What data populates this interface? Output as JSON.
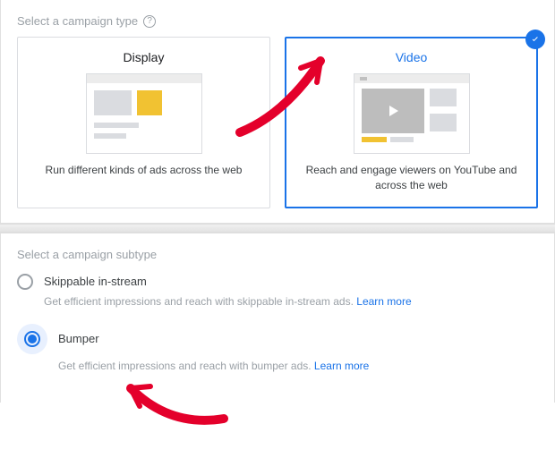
{
  "section_type_label": "Select a campaign type",
  "cards": {
    "display": {
      "title": "Display",
      "desc": "Run different kinds of ads across the web"
    },
    "video": {
      "title": "Video",
      "desc": "Reach and engage viewers on YouTube and across the web"
    }
  },
  "section_subtype_label": "Select a campaign subtype",
  "subtypes": {
    "skippable": {
      "label": "Skippable in-stream",
      "desc": "Get efficient impressions and reach with skippable in-stream ads. ",
      "learn_more": "Learn more"
    },
    "bumper": {
      "label": "Bumper",
      "desc": "Get efficient impressions and reach with bumper ads. ",
      "learn_more": "Learn more"
    }
  }
}
